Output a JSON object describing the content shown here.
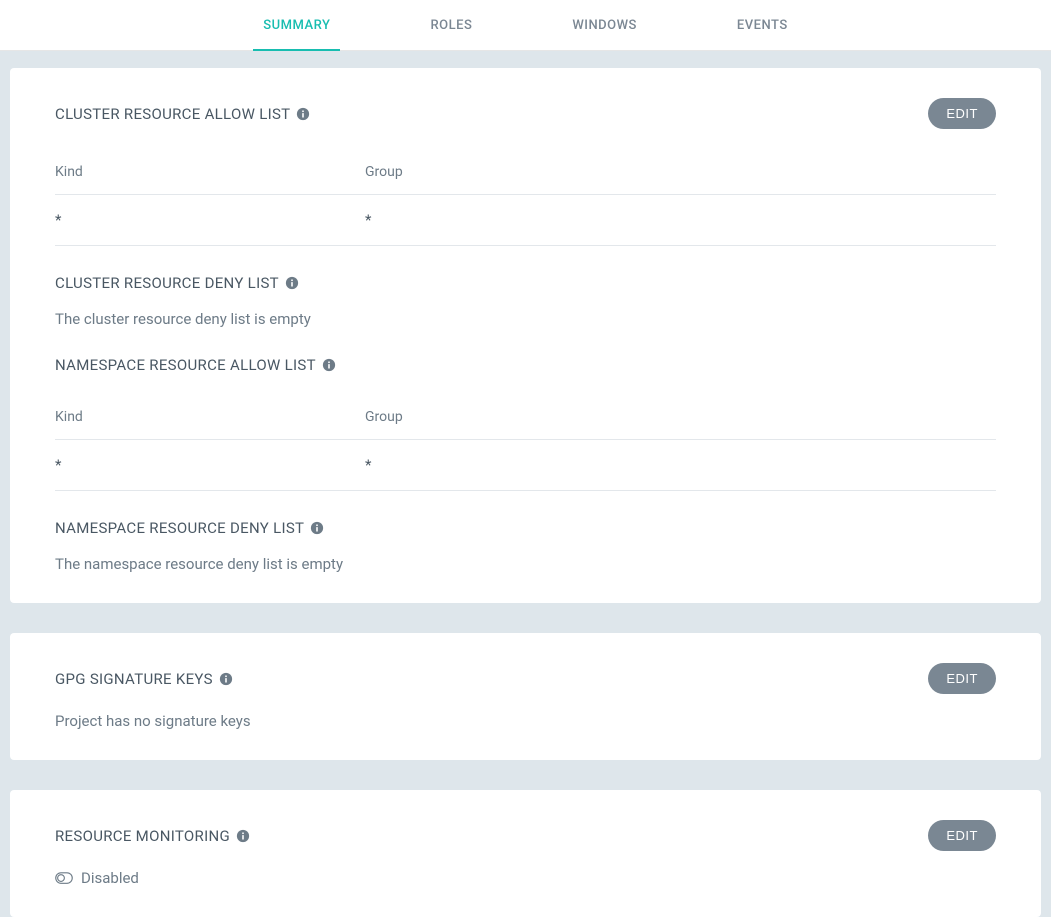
{
  "tabs": {
    "summary": "SUMMARY",
    "roles": "ROLES",
    "windows": "WINDOWS",
    "events": "EVENTS"
  },
  "buttons": {
    "edit": "EDIT"
  },
  "sections": {
    "clusterAllow": {
      "title": "CLUSTER RESOURCE ALLOW LIST",
      "headers": {
        "kind": "Kind",
        "group": "Group"
      },
      "rows": [
        {
          "kind": "*",
          "group": "*"
        }
      ]
    },
    "clusterDeny": {
      "title": "CLUSTER RESOURCE DENY LIST",
      "empty": "The cluster resource deny list is empty"
    },
    "namespaceAllow": {
      "title": "NAMESPACE RESOURCE ALLOW LIST",
      "headers": {
        "kind": "Kind",
        "group": "Group"
      },
      "rows": [
        {
          "kind": "*",
          "group": "*"
        }
      ]
    },
    "namespaceDeny": {
      "title": "NAMESPACE RESOURCE DENY LIST",
      "empty": "The namespace resource deny list is empty"
    },
    "gpg": {
      "title": "GPG SIGNATURE KEYS",
      "empty": "Project has no signature keys"
    },
    "monitoring": {
      "title": "RESOURCE MONITORING",
      "status": "Disabled"
    }
  }
}
